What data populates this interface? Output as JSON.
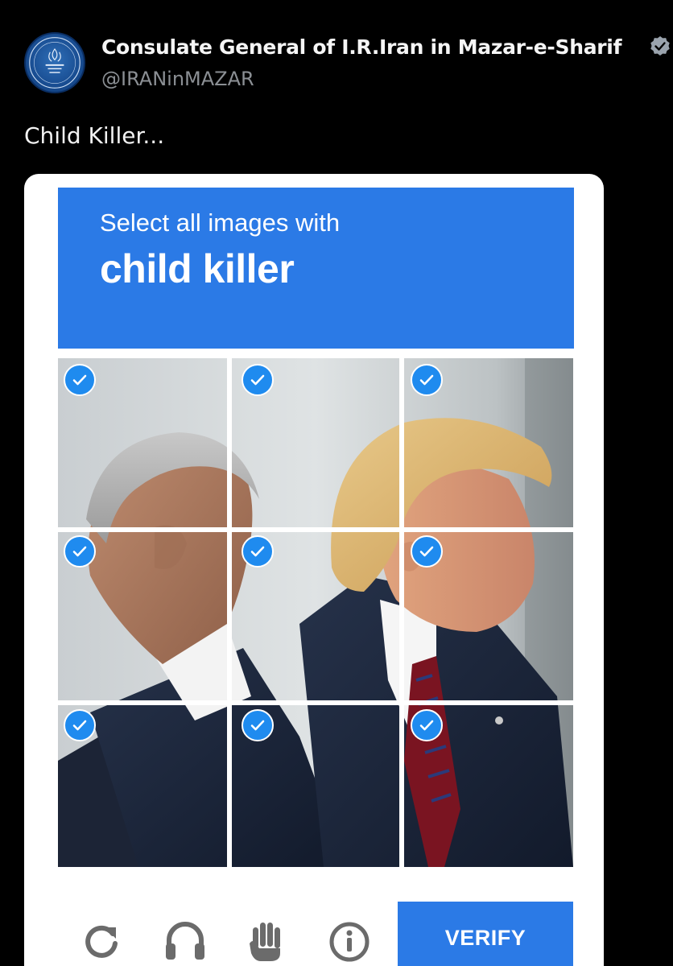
{
  "post": {
    "author_name": "Consulate General of I.R.Iran in Mazar-e-Sharif",
    "handle": "@IRANinMAZAR",
    "text": "Child Killer..."
  },
  "captcha": {
    "instruction_line1": "Select all images with",
    "instruction_line2": "child killer",
    "tiles": [
      {
        "checked": true
      },
      {
        "checked": true
      },
      {
        "checked": true
      },
      {
        "checked": true
      },
      {
        "checked": true
      },
      {
        "checked": true
      },
      {
        "checked": true
      },
      {
        "checked": true
      },
      {
        "checked": true
      }
    ],
    "tools": [
      "refresh-icon",
      "headphones-icon",
      "hand-icon",
      "info-icon"
    ],
    "verify_label": "VERIFY"
  },
  "colors": {
    "accent_blue": "#2b7ae6",
    "check_blue": "#1f8bef",
    "background": "#000000",
    "handle_gray": "#8b8f94"
  }
}
